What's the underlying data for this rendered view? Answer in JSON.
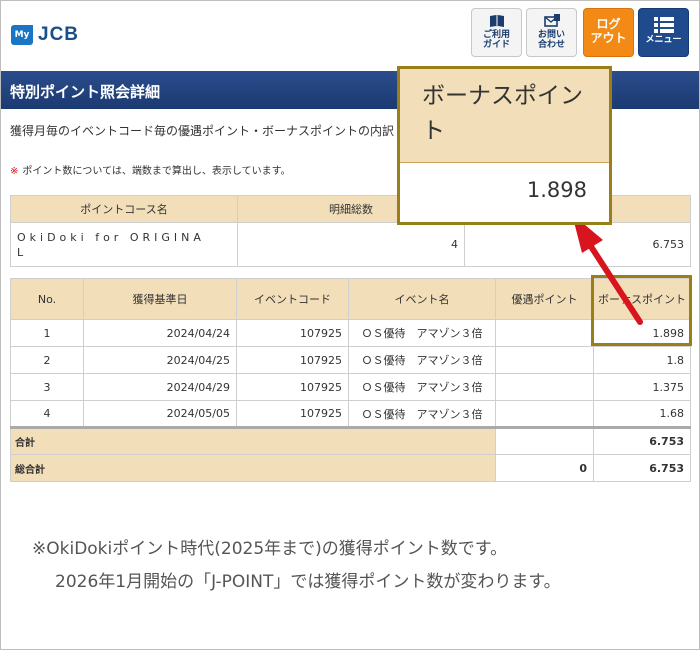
{
  "header": {
    "logo_my": "My",
    "logo_brand": "JCB",
    "guide_label_1": "ご利用",
    "guide_label_2": "ガイド",
    "contact_label_1": "お問い",
    "contact_label_2": "合わせ",
    "logout_label_1": "ログ",
    "logout_label_2": "アウト",
    "menu_label": "メニュー"
  },
  "page": {
    "title": "特別ポイント照会詳細",
    "description": "獲得月毎のイベントコード毎の優遇ポイント・ボーナスポイントの内訳",
    "note_mark": "※",
    "note_text": "ポイント数については、端数まで算出し、表示しています。"
  },
  "summary_table": {
    "headers": [
      "ポイントコース名",
      "明細総数",
      ""
    ],
    "row": {
      "course_line1": "OkiDoki for ORIGINA",
      "course_line2": "L",
      "count": "4",
      "points": "6.753"
    }
  },
  "detail_table": {
    "headers": [
      "No.",
      "獲得基準日",
      "イベントコード",
      "イベント名",
      "優遇ポイント",
      "ボーナスポイント"
    ],
    "rows": [
      {
        "no": "1",
        "date": "2024/04/24",
        "code": "107925",
        "event": "ＯＳ優待　アマゾン３倍",
        "preferred": "",
        "bonus": "1.898"
      },
      {
        "no": "2",
        "date": "2024/04/25",
        "code": "107925",
        "event": "ＯＳ優待　アマゾン３倍",
        "preferred": "",
        "bonus": "1.8"
      },
      {
        "no": "3",
        "date": "2024/04/29",
        "code": "107925",
        "event": "ＯＳ優待　アマゾン３倍",
        "preferred": "",
        "bonus": "1.375"
      },
      {
        "no": "4",
        "date": "2024/05/05",
        "code": "107925",
        "event": "ＯＳ優待　アマゾン３倍",
        "preferred": "",
        "bonus": "1.68"
      }
    ],
    "subtotal": {
      "label": "合計",
      "preferred": "",
      "bonus": "6.753"
    },
    "grand_total": {
      "label": "総合計",
      "preferred": "0",
      "bonus": "6.753"
    }
  },
  "callout": {
    "title": "ボーナスポイント",
    "value": "1.898"
  },
  "footer": {
    "line1": "※OkiDokiポイント時代(2025年まで)の獲得ポイント数です。",
    "line2": "2026年1月開始の「J-POINT」では獲得ポイント数が変わります。"
  },
  "colors": {
    "header_bar": "#1f4a8c",
    "table_header": "#f2deb9",
    "logout": "#f38a16",
    "highlight_border": "#9a7e18",
    "arrow": "#d8141f"
  }
}
